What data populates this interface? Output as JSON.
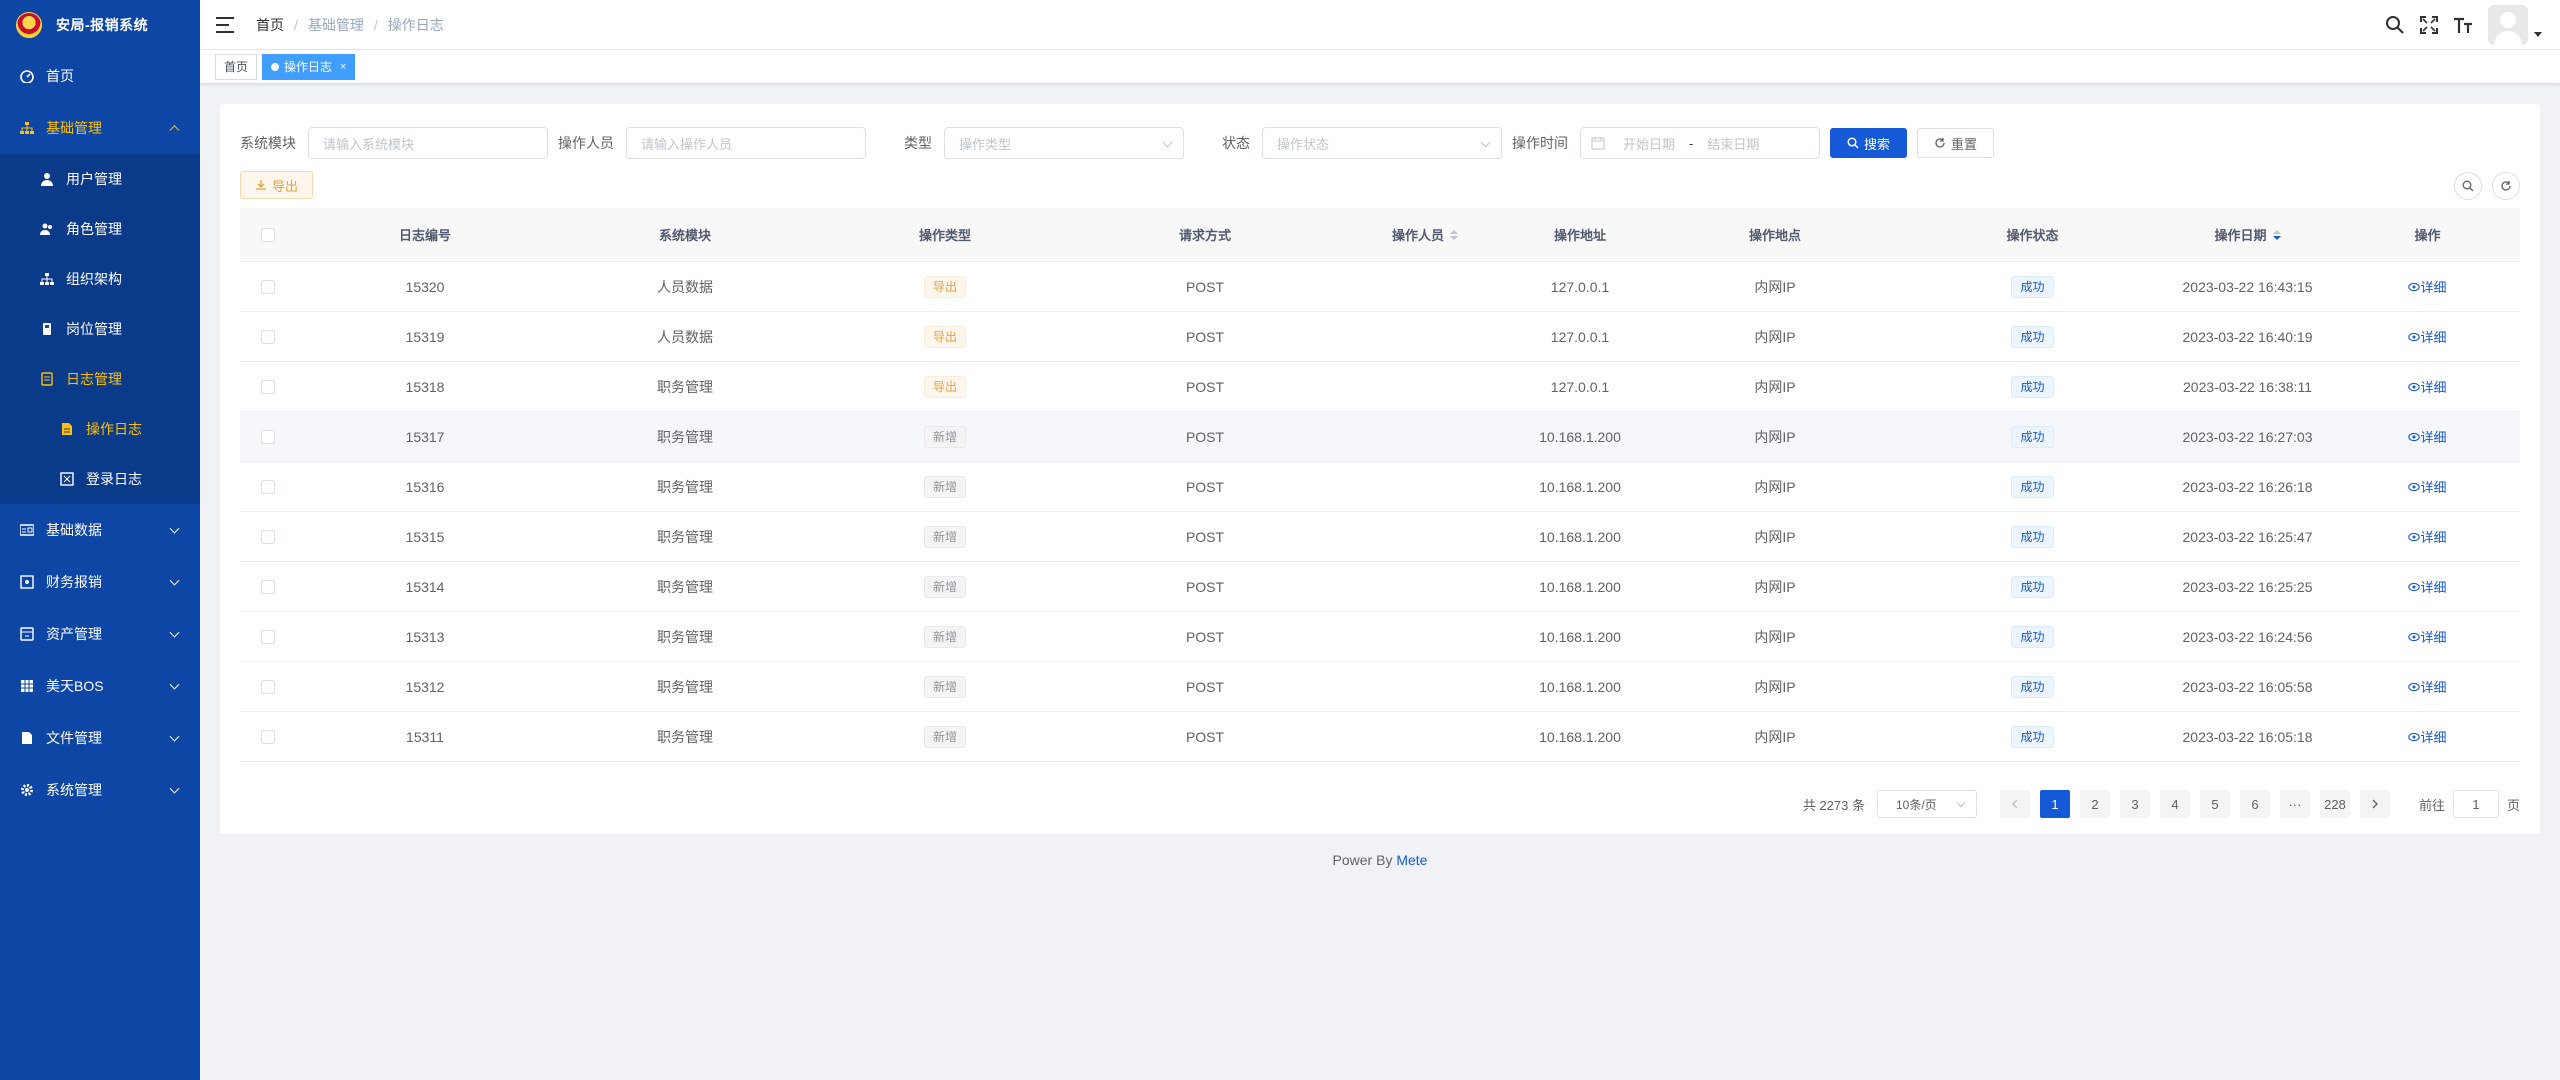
{
  "app": {
    "title": "安局-报销系统"
  },
  "sidebar": {
    "items": [
      {
        "label": "首页",
        "icon": "dashboard-icon"
      },
      {
        "label": "基础管理",
        "icon": "sitemap-icon"
      },
      {
        "label": "用户管理",
        "icon": "user-icon"
      },
      {
        "label": "角色管理",
        "icon": "users-icon"
      },
      {
        "label": "组织架构",
        "icon": "org-icon"
      },
      {
        "label": "岗位管理",
        "icon": "post-icon"
      },
      {
        "label": "日志管理",
        "icon": "log-icon"
      },
      {
        "label": "操作日志",
        "icon": "file-icon"
      },
      {
        "label": "登录日志",
        "icon": "login-log-icon"
      },
      {
        "label": "基础数据",
        "icon": "card-icon"
      },
      {
        "label": "财务报销",
        "icon": "money-icon"
      },
      {
        "label": "资产管理",
        "icon": "asset-icon"
      },
      {
        "label": "美天BOS",
        "icon": "table-icon"
      },
      {
        "label": "文件管理",
        "icon": "doc-icon"
      },
      {
        "label": "系统管理",
        "icon": "gear-icon"
      }
    ]
  },
  "breadcrumb": [
    "首页",
    "基础管理",
    "操作日志"
  ],
  "tags": {
    "home": "首页",
    "current": "操作日志"
  },
  "filters": {
    "module_label": "系统模块",
    "module_placeholder": "请输入系统模块",
    "operator_label": "操作人员",
    "operator_placeholder": "请输入操作人员",
    "type_label": "类型",
    "type_placeholder": "操作类型",
    "status_label": "状态",
    "status_placeholder": "操作状态",
    "time_label": "操作时间",
    "start_placeholder": "开始日期",
    "end_placeholder": "结束日期",
    "range_sep": "-",
    "search_btn": "搜索",
    "reset_btn": "重置"
  },
  "toolbar": {
    "export_btn": "导出"
  },
  "table": {
    "headers": [
      "日志编号",
      "系统模块",
      "操作类型",
      "请求方式",
      "操作人员",
      "操作地址",
      "操作地点",
      "操作状态",
      "操作日期",
      "操作"
    ],
    "rows": [
      {
        "id": "15320",
        "module": "人员数据",
        "type": "导出",
        "type_style": "warn",
        "method": "POST",
        "ip": "127.0.0.1",
        "location": "内网IP",
        "status": "成功",
        "date": "2023-03-22 16:43:15",
        "action": "详细"
      },
      {
        "id": "15319",
        "module": "人员数据",
        "type": "导出",
        "type_style": "warn",
        "method": "POST",
        "ip": "127.0.0.1",
        "location": "内网IP",
        "status": "成功",
        "date": "2023-03-22 16:40:19",
        "action": "详细"
      },
      {
        "id": "15318",
        "module": "职务管理",
        "type": "导出",
        "type_style": "warn",
        "method": "POST",
        "ip": "127.0.0.1",
        "location": "内网IP",
        "status": "成功",
        "date": "2023-03-22 16:38:11",
        "action": "详细"
      },
      {
        "id": "15317",
        "module": "职务管理",
        "type": "新增",
        "type_style": "info",
        "method": "POST",
        "ip": "10.168.1.200",
        "location": "内网IP",
        "status": "成功",
        "date": "2023-03-22 16:27:03",
        "action": "详细"
      },
      {
        "id": "15316",
        "module": "职务管理",
        "type": "新增",
        "type_style": "info",
        "method": "POST",
        "ip": "10.168.1.200",
        "location": "内网IP",
        "status": "成功",
        "date": "2023-03-22 16:26:18",
        "action": "详细"
      },
      {
        "id": "15315",
        "module": "职务管理",
        "type": "新增",
        "type_style": "info",
        "method": "POST",
        "ip": "10.168.1.200",
        "location": "内网IP",
        "status": "成功",
        "date": "2023-03-22 16:25:47",
        "action": "详细"
      },
      {
        "id": "15314",
        "module": "职务管理",
        "type": "新增",
        "type_style": "info",
        "method": "POST",
        "ip": "10.168.1.200",
        "location": "内网IP",
        "status": "成功",
        "date": "2023-03-22 16:25:25",
        "action": "详细"
      },
      {
        "id": "15313",
        "module": "职务管理",
        "type": "新增",
        "type_style": "info",
        "method": "POST",
        "ip": "10.168.1.200",
        "location": "内网IP",
        "status": "成功",
        "date": "2023-03-22 16:24:56",
        "action": "详细"
      },
      {
        "id": "15312",
        "module": "职务管理",
        "type": "新增",
        "type_style": "info",
        "method": "POST",
        "ip": "10.168.1.200",
        "location": "内网IP",
        "status": "成功",
        "date": "2023-03-22 16:05:58",
        "action": "详细"
      },
      {
        "id": "15311",
        "module": "职务管理",
        "type": "新增",
        "type_style": "info",
        "method": "POST",
        "ip": "10.168.1.200",
        "location": "内网IP",
        "status": "成功",
        "date": "2023-03-22 16:05:18",
        "action": "详细"
      }
    ]
  },
  "pagination": {
    "total": "共 2273 条",
    "page_size": "10条/页",
    "pages": [
      "1",
      "2",
      "3",
      "4",
      "5",
      "6",
      "···",
      "228"
    ],
    "goto_label": "前往",
    "goto_value": "1",
    "goto_suffix": "页"
  },
  "footer": {
    "prefix": "Power By",
    "link": "Mete"
  },
  "colors": {
    "sidebar": "#0d46a4",
    "primary": "#1559d6",
    "active_menu": "#ffc107"
  }
}
